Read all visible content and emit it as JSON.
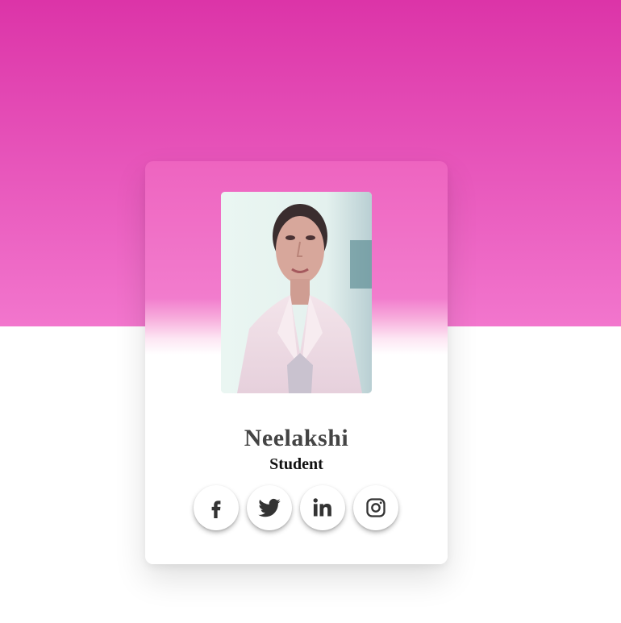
{
  "profile": {
    "name": "Neelakshi",
    "role": "Student",
    "photo_icon": "profile-photo"
  },
  "socials": [
    {
      "icon": "facebook-icon"
    },
    {
      "icon": "twitter-icon"
    },
    {
      "icon": "linkedin-icon"
    },
    {
      "icon": "instagram-icon"
    }
  ],
  "colors": {
    "header_top": "#dc34a8",
    "header_bottom": "#f276cd",
    "name_text": "#444444",
    "role_text": "#111111",
    "icon": "#333333"
  }
}
